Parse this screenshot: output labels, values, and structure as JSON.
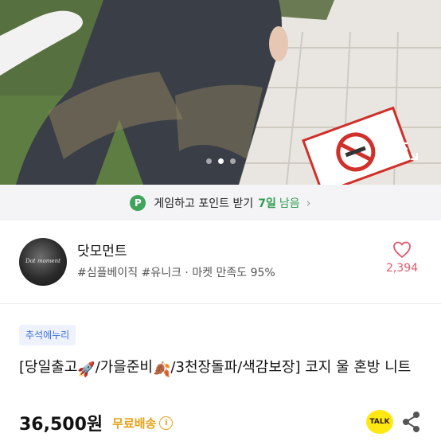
{
  "hero": {
    "page_count": 3,
    "active_index": 1,
    "expand_icon": "expand-icon"
  },
  "banner": {
    "badge": "P",
    "text": "게임하고 포인트 받기",
    "days": "7일",
    "remain": "남음",
    "chevron": "›"
  },
  "seller": {
    "name": "닷모먼트",
    "avatar_text": "Dot moment",
    "tags": "#심플베이직 #유니크 · 마켓 만족도 95%",
    "likes": "2,394"
  },
  "product": {
    "tag": "추석에누리",
    "title_part1": "[당일출고",
    "emoji1": "🚀",
    "title_part2": "/가을준비",
    "emoji2": "🍂",
    "title_part3": "/3천장돌파/색감보장] 코지 울 혼방 니트",
    "price": "36,500원",
    "shipping": "무료배송",
    "info": "i",
    "talk": "TALK"
  },
  "colors": {
    "accent_green": "#2f9a4e",
    "like_red": "#e3566b",
    "shipping_orange": "#e6a21a",
    "tag_blue": "#3b6ee0",
    "kakao_yellow": "#ffe812"
  }
}
